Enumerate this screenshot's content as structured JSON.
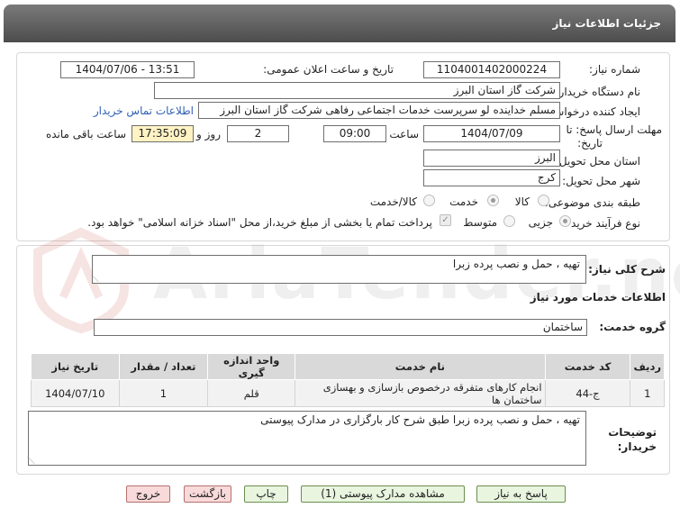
{
  "header": {
    "title": "جزئیات اطلاعات نیاز"
  },
  "form": {
    "need_number_label": "شماره نیاز:",
    "need_number": "1104001402000224",
    "announce_label": "تاریخ و ساعت اعلان عمومی:",
    "announce_value": "1404/07/06 - 13:51",
    "buyer_org_label": "نام دستگاه خریدار:",
    "buyer_org": "شرکت گاز استان البرز",
    "requester_label": "ایجاد کننده درخواست:",
    "requester": "مسلم خداینده لو سرپرست خدمات اجتماعی رفاهی شرکت گاز استان البرز",
    "contact_link": "اطلاعات تماس خریدار",
    "deadline_label_1": "مهلت ارسال پاسخ: تا",
    "deadline_label_2": "تاریخ:",
    "deadline_date": "1404/07/09",
    "time_label": "ساعت",
    "deadline_time": "09:00",
    "days_value": "2",
    "days_label": "روز و",
    "remaining_time": "17:35:09",
    "remaining_label": "ساعت باقی مانده",
    "province_label": "استان محل تحویل:",
    "province": "البرز",
    "city_label": "شهر محل تحویل:",
    "city": "کرج",
    "category_label": "طبقه بندی موضوعی:",
    "category_options": [
      "کالا",
      "خدمت",
      "کالا/خدمت"
    ],
    "category_selected": "خدمت",
    "process_label": "نوع فرآیند خرید :",
    "process_options": [
      "جزیی",
      "متوسط"
    ],
    "process_selected": "جزیی",
    "payment_note": "پرداخت تمام یا بخشی از مبلغ خرید،از محل \"اسناد خزانه اسلامی\" خواهد بود."
  },
  "watermark": {
    "text": "AriaTender.neT"
  },
  "summary": {
    "label": "شرح کلی نیاز:",
    "value": "تهیه ، حمل و نصب پرده زبرا"
  },
  "services": {
    "section_title": "اطلاعات خدمات مورد نیاز",
    "group_label": "گروه خدمت:",
    "group_value": "ساختمان",
    "columns": [
      "ردیف",
      "کد خدمت",
      "نام خدمت",
      "واحد اندازه گیری",
      "تعداد / مقدار",
      "تاریخ نیاز"
    ],
    "rows": [
      {
        "row": "1",
        "code": "ج-44",
        "name": "انجام کارهای متفرقه درخصوص بازسازی و بهسازی ساختمان ها",
        "unit": "قلم",
        "qty": "1",
        "date": "1404/07/10"
      }
    ]
  },
  "buyer_notes": {
    "label_1": "توضیحات",
    "label_2": "خریدار:",
    "value": "تهیه ، حمل و نصب پرده زبرا طبق شرح کار بارگزاری در مدارک پیوستی"
  },
  "buttons": {
    "reply": "پاسخ به نیاز",
    "attachments": "مشاهده مدارک پیوستی (1)",
    "print": "چاپ",
    "back": "بازگشت",
    "exit": "خروج"
  }
}
